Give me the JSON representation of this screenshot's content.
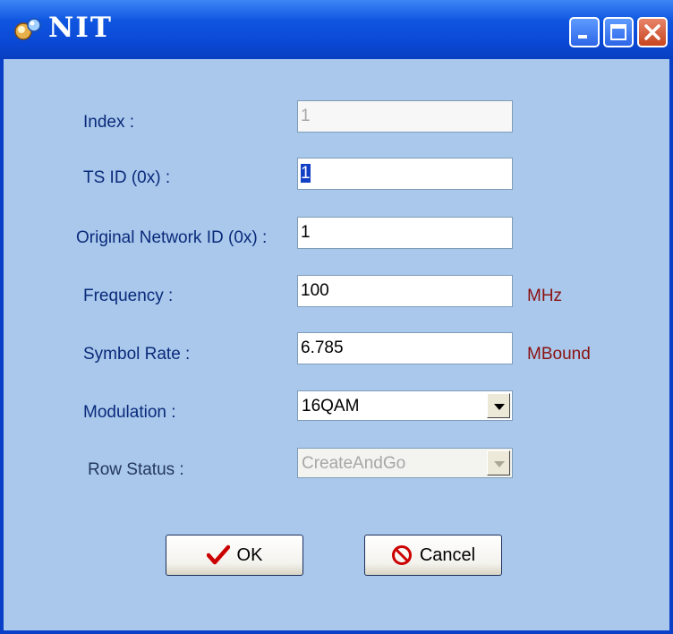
{
  "window": {
    "title": "NIT",
    "icon": "app-icon",
    "controls": [
      "minimize-icon",
      "maximize-icon",
      "close-icon"
    ]
  },
  "form": {
    "index": {
      "label": "Index :",
      "value": "1",
      "disabled": true
    },
    "ts_id": {
      "label": "TS ID (0x) :",
      "value": "1",
      "selected": true
    },
    "original_network_id": {
      "label": "Original Network ID (0x) :",
      "value": "1"
    },
    "frequency": {
      "label": "Frequency :",
      "value": "100",
      "unit": "MHz"
    },
    "symbol_rate": {
      "label": "Symbol Rate :",
      "value": "6.785",
      "unit": "MBound"
    },
    "modulation": {
      "label": "Modulation :",
      "value": "16QAM"
    },
    "row_status": {
      "label": "Row Status :",
      "value": "CreateAndGo",
      "disabled": true
    }
  },
  "buttons": {
    "ok": "OK",
    "cancel": "Cancel"
  },
  "colors": {
    "dialog_bg": "#a9c8ec",
    "titlebar": "#0a49d6",
    "label": "#0a2a7a",
    "unit": "#8a1212",
    "ok_check": "#cc0000",
    "cancel_icon": "#cc0000"
  }
}
